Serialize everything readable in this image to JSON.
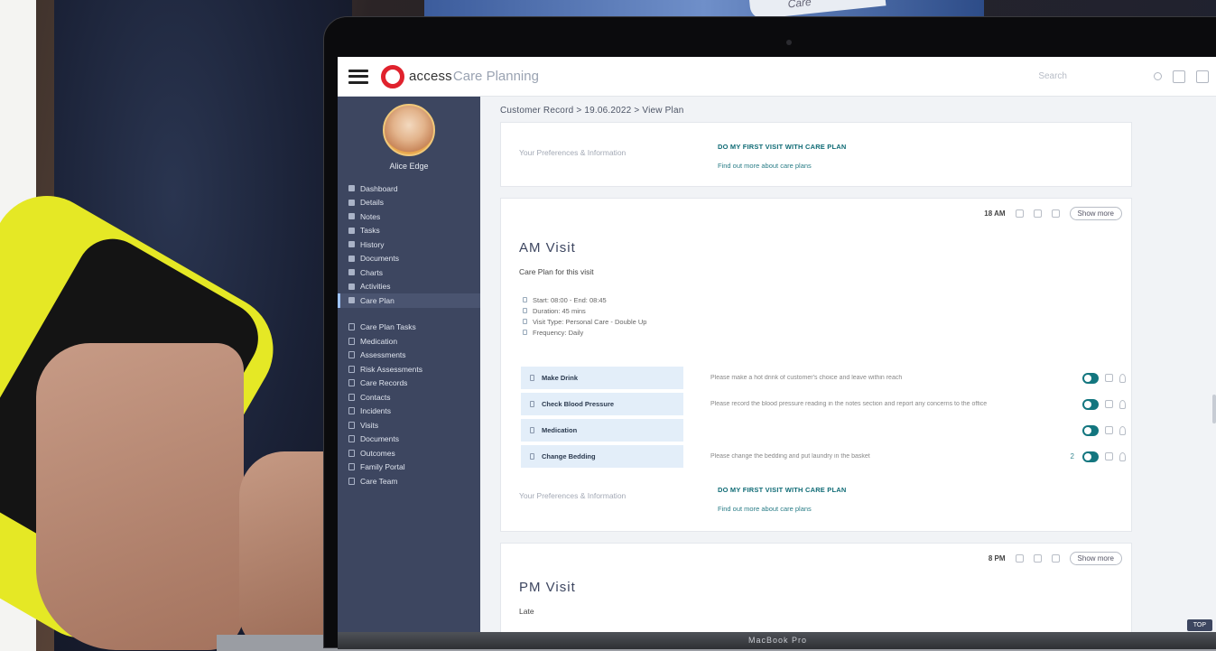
{
  "photo": {
    "badge_text": "Care"
  },
  "app": {
    "brand": "access",
    "brand_sub": "Care Planning",
    "top_link": "Search"
  },
  "user": {
    "name": "Alice Edge"
  },
  "sidebar": {
    "primary": [
      {
        "label": "Dashboard"
      },
      {
        "label": "Details"
      },
      {
        "label": "Notes"
      },
      {
        "label": "Tasks"
      },
      {
        "label": "History"
      },
      {
        "label": "Documents"
      },
      {
        "label": "Charts"
      },
      {
        "label": "Activities"
      },
      {
        "label": "Care Plan",
        "active": true
      }
    ],
    "secondary": [
      {
        "label": "Care Plan Tasks"
      },
      {
        "label": "Medication"
      },
      {
        "label": "Assessments"
      },
      {
        "label": "Risk Assessments"
      },
      {
        "label": "Care Records"
      },
      {
        "label": "Contacts"
      },
      {
        "label": "Incidents"
      },
      {
        "label": "Visits"
      },
      {
        "label": "Documents"
      },
      {
        "label": "Outcomes"
      },
      {
        "label": "Family Portal"
      },
      {
        "label": "Care Team"
      }
    ]
  },
  "breadcrumb": "Customer Record > 19.06.2022 > View Plan",
  "card1": {
    "label": "Your Preferences & Information",
    "link_title": "DO MY FIRST VISIT WITH CARE PLAN",
    "link_sub": "Find out more about care plans"
  },
  "card2": {
    "tools_label": "18 AM",
    "pill": "Show more",
    "title": "AM Visit",
    "subtitle": "Care Plan for this visit",
    "checklist": [
      "Start: 08:00 - End: 08:45",
      "Duration: 45 mins",
      "Visit Type: Personal Care - Double Up",
      "Frequency: Daily"
    ],
    "tasks": [
      {
        "name": "Make Drink",
        "note": "Please make a hot drink of customer's choice and leave within reach",
        "extra": ""
      },
      {
        "name": "Check Blood Pressure",
        "note": "Please record the blood pressure reading in the notes section and report any concerns to the office",
        "extra": ""
      },
      {
        "name": "Medication",
        "note": "",
        "extra": ""
      },
      {
        "name": "Change Bedding",
        "note": "Please change the bedding and put laundry in the basket",
        "extra": "2"
      }
    ],
    "footer_label": "Your Preferences & Information",
    "footer_link_title": "DO MY FIRST VISIT WITH CARE PLAN",
    "footer_link_sub": "Find out more about care plans"
  },
  "card3": {
    "tools_label": "8 PM",
    "pill": "Show more",
    "title": "PM Visit",
    "subtitle": "Late"
  },
  "hinge_label": "MacBook Pro",
  "toast": "TOP"
}
